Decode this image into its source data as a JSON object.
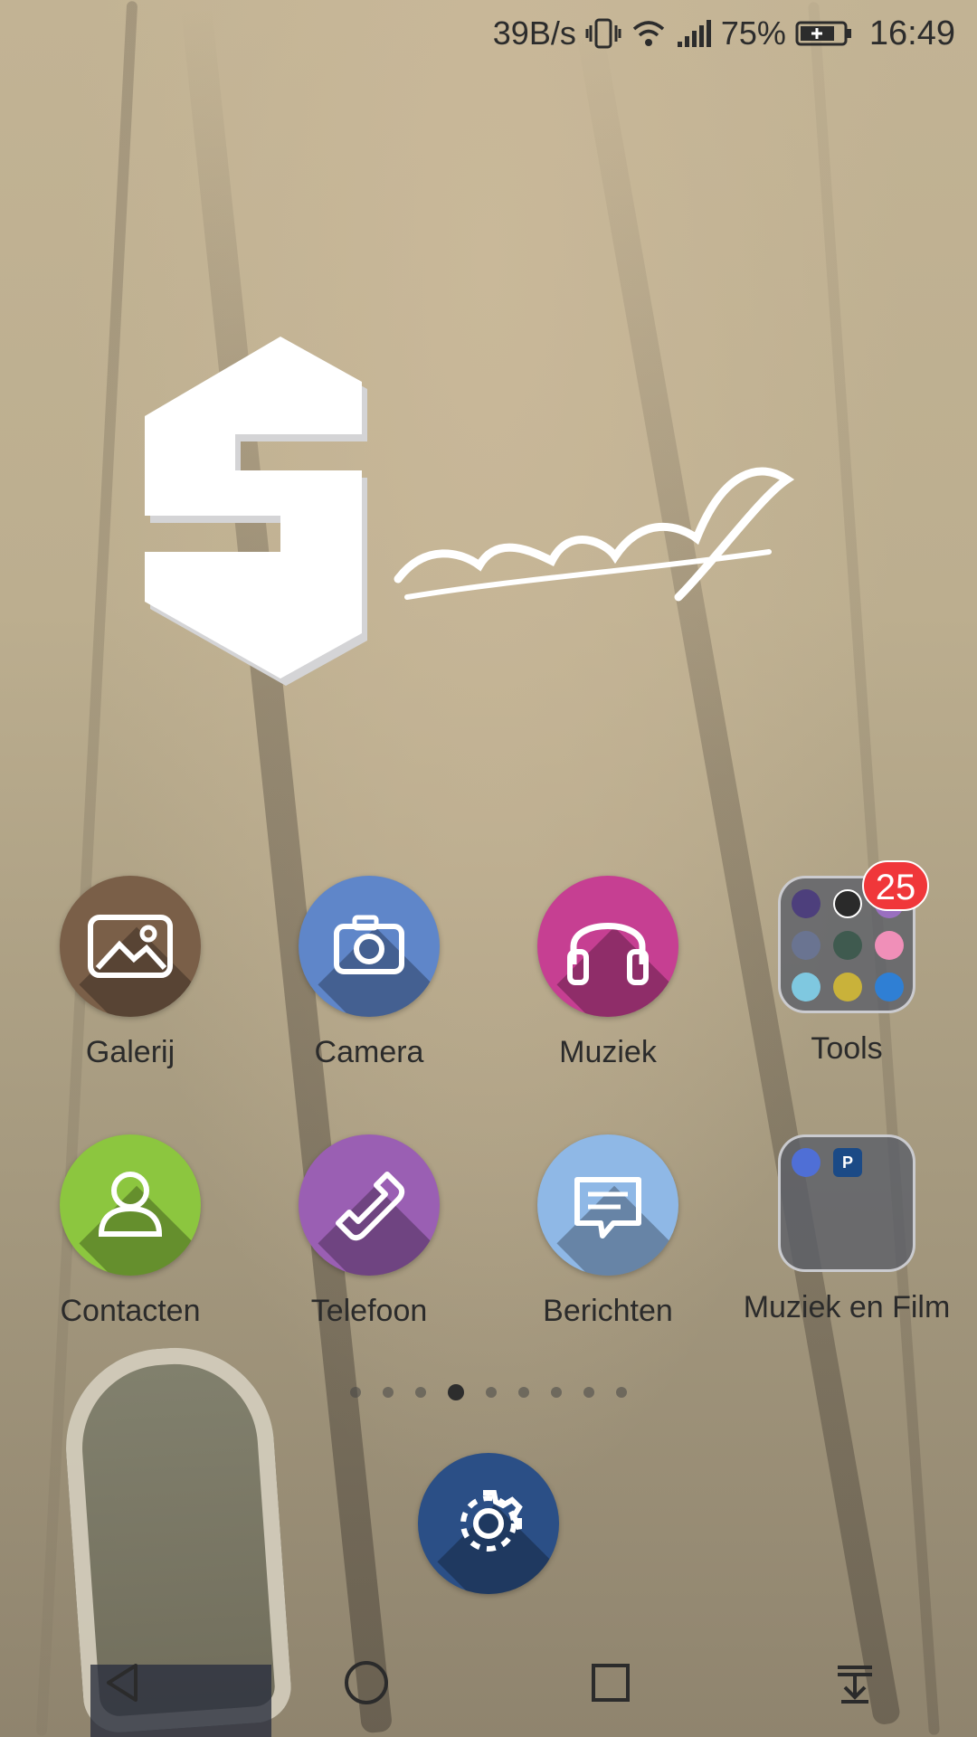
{
  "status_bar": {
    "net_speed": "39B/s",
    "battery_percent": "75%",
    "time": "16:49",
    "icons": [
      "vibrate-icon",
      "wifi-icon",
      "signal-icon",
      "battery-charging-icon"
    ]
  },
  "wallpaper": {
    "logo_text": "Sample"
  },
  "apps_row1": [
    {
      "label": "Galerij",
      "icon": "gallery-icon",
      "color": "#7a5f48"
    },
    {
      "label": "Camera",
      "icon": "camera-icon",
      "color": "#5f86c9"
    },
    {
      "label": "Muziek",
      "icon": "headphones-icon",
      "color": "#c63f92"
    }
  ],
  "folder_tools": {
    "label": "Tools",
    "badge": "25",
    "mini_icons": [
      "shield-icon",
      "clock-icon",
      "mic-icon",
      "weather-icon",
      "calculator-icon",
      "recorder-icon",
      "mail-icon",
      "flashlight-icon",
      "lock-icon"
    ]
  },
  "apps_row2": [
    {
      "label": "Contacten",
      "icon": "contact-icon",
      "color": "#8cc63f"
    },
    {
      "label": "Telefoon",
      "icon": "phone-icon",
      "color": "#9a5fb3"
    },
    {
      "label": "Berichten",
      "icon": "message-icon",
      "color": "#8fb8e6"
    }
  ],
  "folder_media": {
    "label": "Muziek en Film",
    "mini_icons": [
      "video-play-icon",
      "pandora-icon"
    ],
    "mini_text": "P"
  },
  "page_indicator": {
    "count": 9,
    "active": 4
  },
  "dock": {
    "icon": "settings-gear-icon",
    "color": "#2b4f86"
  },
  "nav_bar": [
    "back-icon",
    "home-icon",
    "recents-icon",
    "notifications-pull-icon"
  ]
}
